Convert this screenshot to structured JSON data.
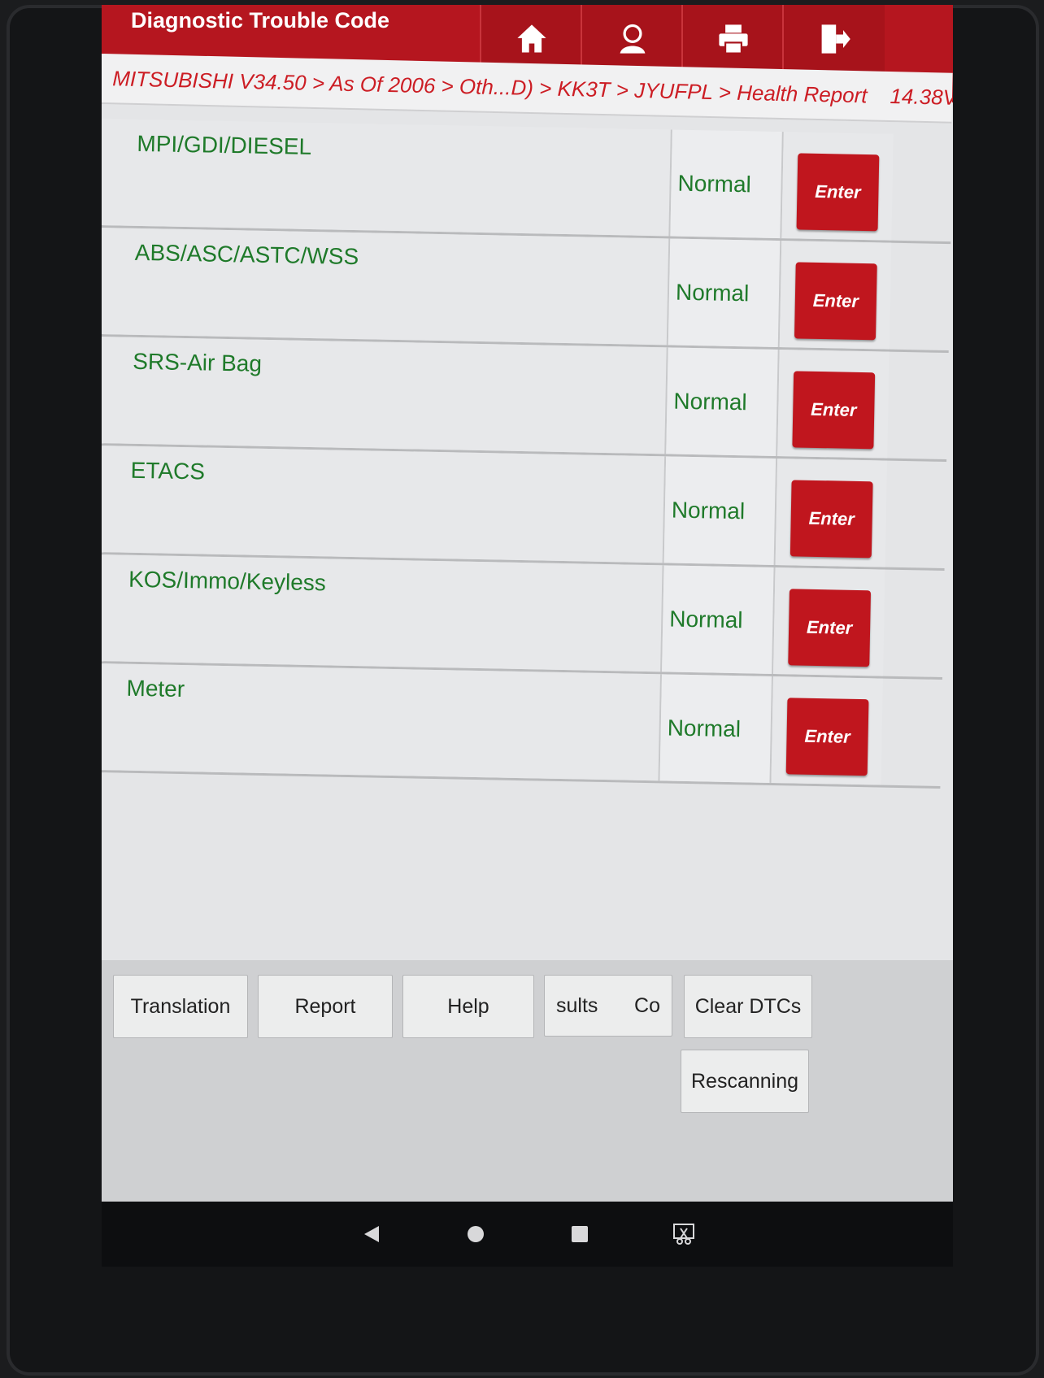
{
  "header": {
    "title": "Diagnostic Trouble Code",
    "buttons": [
      {
        "icon": "home-icon"
      },
      {
        "icon": "user-icon"
      },
      {
        "icon": "printer-icon"
      },
      {
        "icon": "exit-icon"
      }
    ]
  },
  "breadcrumb": {
    "path": "MITSUBISHI V34.50 > As Of 2006 > Oth...D) > KK3T > JYUFPL > Health Report",
    "voltage": "14.38V",
    "icon": "battery-icon"
  },
  "systems": [
    {
      "name": "MPI/GDI/DIESEL",
      "status": "Normal",
      "action": "Enter"
    },
    {
      "name": "ABS/ASC/ASTC/WSS",
      "status": "Normal",
      "action": "Enter"
    },
    {
      "name": "SRS-Air Bag",
      "status": "Normal",
      "action": "Enter"
    },
    {
      "name": "ETACS",
      "status": "Normal",
      "action": "Enter"
    },
    {
      "name": "KOS/Immo/Keyless",
      "status": "Normal",
      "action": "Enter"
    },
    {
      "name": "Meter",
      "status": "Normal",
      "action": "Enter"
    }
  ],
  "toolbar": {
    "translation": "Translation",
    "report": "Report",
    "help": "Help",
    "results_partial": "sults",
    "compare_partial": "Co",
    "clear_dtcs": "Clear DTCs",
    "rescanning": "Rescanning"
  },
  "navbar": [
    "back-icon",
    "home-circle-icon",
    "recents-icon",
    "screenshot-icon"
  ],
  "colors": {
    "header_red": "#b5161f",
    "enter_red": "#c0161e",
    "status_green": "#1f7a2a",
    "breadcrumb_red": "#cc1d24"
  }
}
